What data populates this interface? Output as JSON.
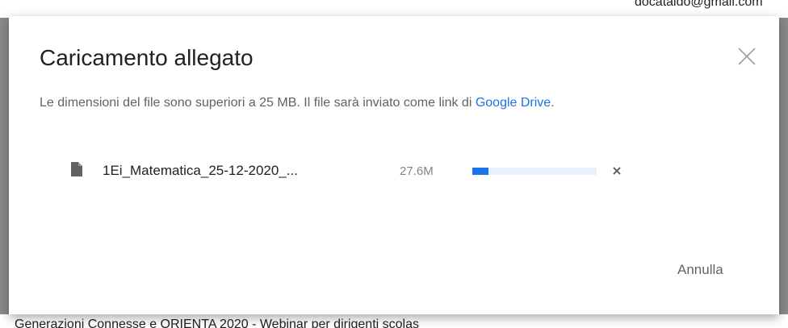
{
  "background": {
    "top_text": "docataldo@gmail.com",
    "bottom_text": "Generazioni Connesse e ORIENTA 2020 - Webinar per dirigenti scolas"
  },
  "dialog": {
    "title": "Caricamento allegato",
    "close_icon": "close-icon",
    "message_prefix": "Le dimensioni del file sono superiori a 25 MB. Il file sarà inviato come link di ",
    "message_link": "Google Drive",
    "message_suffix": ".",
    "file": {
      "icon": "file-icon",
      "name": "1Ei_Matematica_25-12-2020_...",
      "size": "27.6M",
      "progress_fraction": 0.13,
      "remove_icon": "remove-icon"
    },
    "cancel_label": "Annulla"
  },
  "colors": {
    "accent": "#1a73e8",
    "progress_track": "#e8f0fe",
    "text_primary": "#202124",
    "text_secondary": "#5f6368"
  }
}
